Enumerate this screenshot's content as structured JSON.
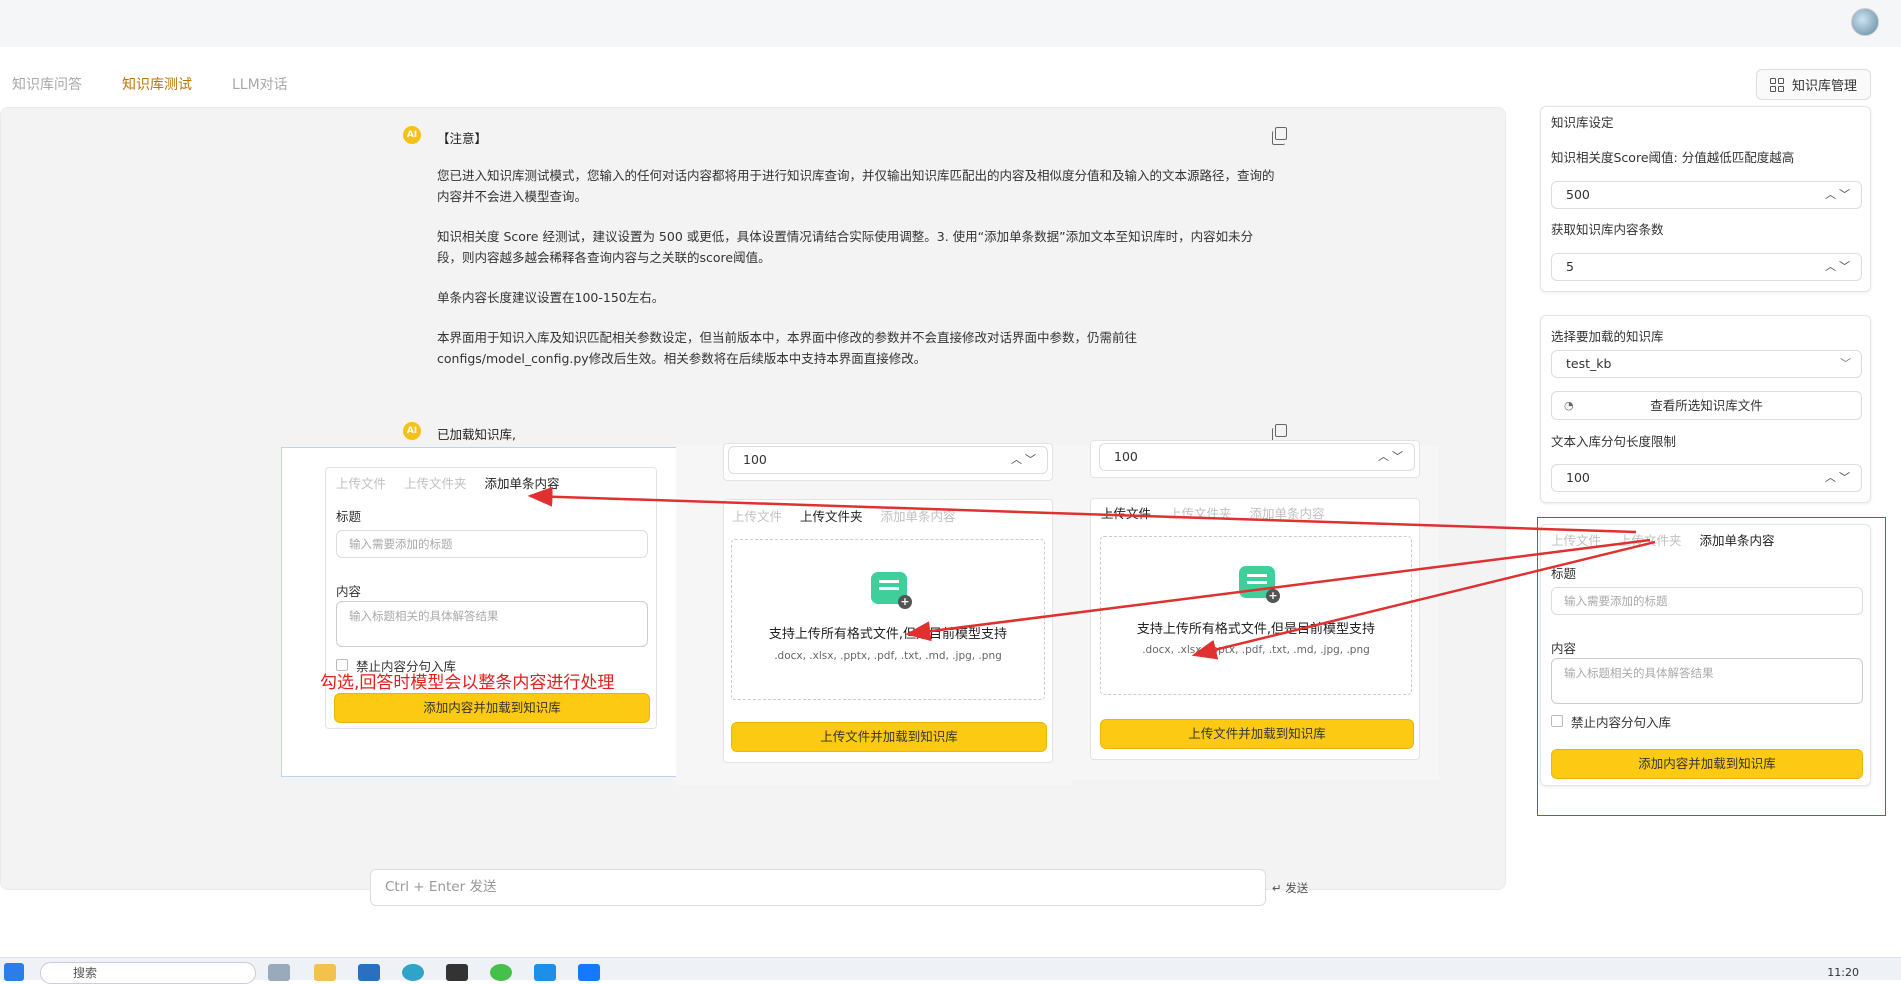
{
  "tabs": [
    "知识库问答",
    "知识库测试",
    "LLM对话"
  ],
  "kb_manage_label": "知识库管理",
  "messages": [
    {
      "avatar": "AI",
      "title": "【注意】",
      "paragraphs": [
        "您已进入知识库测试模式，您输入的任何对话内容都将用于进行知识库查询，并仅输出知识库匹配出的内容及相似度分值和及输入的文本源路径，查询的内容并不会进入模型查询。",
        "知识相关度 Score 经测试，建议设置为 500 或更低，具体设置情况请结合实际使用调整。3. 使用“添加单条数据”添加文本至知识库时，内容如未分段，则内容越多越会稀释各查询内容与之关联的score阈值。",
        "单条内容长度建议设置在100-150左右。",
        "本界面用于知识入库及知识匹配相关参数设定，但当前版本中，本界面中修改的参数并不会直接修改对话界面中参数，仍需前往configs/model_config.py修改后生效。相关参数将在后续版本中支持本界面直接修改。"
      ]
    },
    {
      "avatar": "AI",
      "title": "已加载知识库,"
    }
  ],
  "input": {
    "placeholder": "Ctrl + Enter 发送",
    "send_label": "↵ 发送"
  },
  "sidebar": {
    "kb_settings": {
      "title": "知识库设定",
      "score_label": "知识相关度Score阈值: 分值越低匹配度越高",
      "score_value": "500",
      "topk_label": "获取知识库内容条数",
      "topk_value": "5"
    },
    "kb_select": {
      "label": "选择要加载的知识库",
      "value": "test_kb",
      "view_files_label": "查看所选知识库文件",
      "chunk_label": "文本入库分句长度限制",
      "chunk_value": "100"
    },
    "add_panel": {
      "tabs": [
        "上传文件",
        "上传文件夹",
        "添加单条内容"
      ],
      "title_label": "标题",
      "title_placeholder": "输入需要添加的标题",
      "content_label": "内容",
      "content_placeholder": "输入标题相关的具体解答结果",
      "no_split_label": "禁止内容分句入库",
      "submit_label": "添加内容并加载到知识库"
    }
  },
  "overlay": {
    "single": {
      "tabs": [
        "上传文件",
        "上传文件夹",
        "添加单条内容"
      ],
      "title_label": "标题",
      "title_placeholder": "输入需要添加的标题",
      "content_label": "内容",
      "content_placeholder": "输入标题相关的具体解答结果",
      "no_split_label": "禁止内容分句入库",
      "submit_label": "添加内容并加载到知识库"
    },
    "annotation": "勾选,回答时模型会以整条内容进行处理",
    "folder": {
      "value": "100",
      "tabs": [
        "上传文件",
        "上传文件夹",
        "添加单条内容"
      ],
      "upload_title": "支持上传所有格式文件,但是目前模型支持",
      "upload_formats": ".docx, .xlsx, .pptx, .pdf, .txt, .md, .jpg, .png",
      "submit_label": "上传文件并加载到知识库"
    },
    "file": {
      "value": "100",
      "tabs": [
        "上传文件",
        "上传文件夹",
        "添加单条内容"
      ],
      "upload_title": "支持上传所有格式文件,但是目前模型支持",
      "upload_formats": ".docx, .xlsx, .pptx, .pdf, .txt, .md, .jpg, .png",
      "submit_label": "上传文件并加载到知识库"
    }
  },
  "taskbar": {
    "search": "搜索",
    "time": "11:20"
  },
  "colors": {
    "accent": "#b8770c",
    "button": "#fcca12",
    "annotation": "#e02020"
  }
}
